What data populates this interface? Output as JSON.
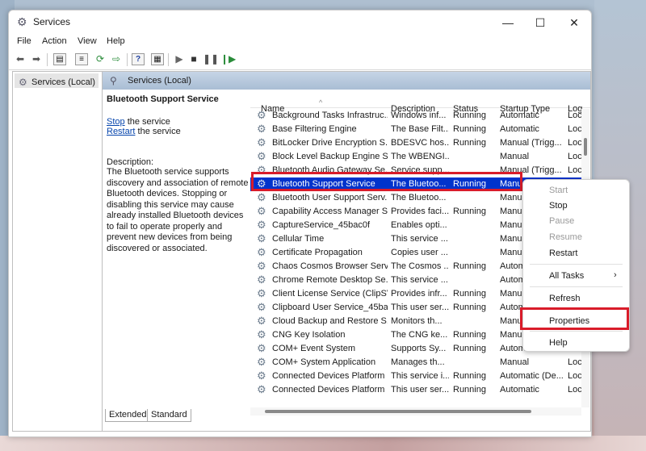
{
  "window": {
    "title": "Services"
  },
  "menu": [
    "File",
    "Action",
    "View",
    "Help"
  ],
  "tree": {
    "label": "Services (Local)"
  },
  "pane_header": "Services (Local)",
  "details": {
    "service_name": "Bluetooth Support Service",
    "stop_link": "Stop",
    "stop_suffix": " the service",
    "restart_link": "Restart",
    "restart_suffix": " the service",
    "description_label": "Description:",
    "description": "The Bluetooth service supports discovery and association of remote Bluetooth devices.  Stopping or disabling this service may cause already installed Bluetooth devices to fail to operate properly and prevent new devices from being discovered or associated."
  },
  "columns": [
    "Name",
    "Description",
    "Status",
    "Startup Type",
    "Log"
  ],
  "rows": [
    {
      "name": "Background Tasks Infrastruc...",
      "desc": "Windows inf...",
      "status": "Running",
      "startup": "Automatic",
      "log": "Loc"
    },
    {
      "name": "Base Filtering Engine",
      "desc": "The Base Filt...",
      "status": "Running",
      "startup": "Automatic",
      "log": "Loc"
    },
    {
      "name": "BitLocker Drive Encryption S...",
      "desc": "BDESVC hos...",
      "status": "Running",
      "startup": "Manual (Trigg...",
      "log": "Loc"
    },
    {
      "name": "Block Level Backup Engine S...",
      "desc": "The WBENGI...",
      "status": "",
      "startup": "Manual",
      "log": "Loc"
    },
    {
      "name": "Bluetooth Audio Gateway Se...",
      "desc": "Service supp...",
      "status": "",
      "startup": "Manual (Trigg...",
      "log": "Loc"
    },
    {
      "name": "Bluetooth Support Service",
      "desc": "The Bluetoo...",
      "status": "Running",
      "startup": "Manu",
      "log": ""
    },
    {
      "name": "Bluetooth User Support Serv...",
      "desc": "The Bluetoo...",
      "status": "",
      "startup": "Manu",
      "log": ""
    },
    {
      "name": "Capability Access Manager S...",
      "desc": "Provides faci...",
      "status": "Running",
      "startup": "Manu",
      "log": ""
    },
    {
      "name": "CaptureService_45bac0f",
      "desc": "Enables opti...",
      "status": "",
      "startup": "Manu",
      "log": ""
    },
    {
      "name": "Cellular Time",
      "desc": "This service ...",
      "status": "",
      "startup": "Manu",
      "log": ""
    },
    {
      "name": "Certificate Propagation",
      "desc": "Copies user ...",
      "status": "",
      "startup": "Manu",
      "log": ""
    },
    {
      "name": "Chaos Cosmos Browser Servi...",
      "desc": "The Cosmos ...",
      "status": "Running",
      "startup": "Autom",
      "log": ""
    },
    {
      "name": "Chrome Remote Desktop Se...",
      "desc": "This service ...",
      "status": "",
      "startup": "Autom",
      "log": ""
    },
    {
      "name": "Client License Service (ClipSV...",
      "desc": "Provides infr...",
      "status": "Running",
      "startup": "Manu",
      "log": ""
    },
    {
      "name": "Clipboard User Service_45ba...",
      "desc": "This user ser...",
      "status": "Running",
      "startup": "Autom",
      "log": ""
    },
    {
      "name": "Cloud Backup and Restore S...",
      "desc": "Monitors th...",
      "status": "",
      "startup": "Manu",
      "log": ""
    },
    {
      "name": "CNG Key Isolation",
      "desc": "The CNG ke...",
      "status": "Running",
      "startup": "Manu",
      "log": ""
    },
    {
      "name": "COM+ Event System",
      "desc": "Supports Sy...",
      "status": "Running",
      "startup": "Autom",
      "log": ""
    },
    {
      "name": "COM+ System Application",
      "desc": "Manages th...",
      "status": "",
      "startup": "Manual",
      "log": "Loc"
    },
    {
      "name": "Connected Devices Platform ...",
      "desc": "This service i...",
      "status": "Running",
      "startup": "Automatic (De...",
      "log": "Loc"
    },
    {
      "name": "Connected Devices Platform ...",
      "desc": "This user ser...",
      "status": "Running",
      "startup": "Automatic",
      "log": "Loc"
    }
  ],
  "tabs": [
    "Extended",
    "Standard"
  ],
  "context_menu": {
    "start": "Start",
    "stop": "Stop",
    "pause": "Pause",
    "resume": "Resume",
    "restart": "Restart",
    "all_tasks": "All Tasks",
    "all_tasks_arrow": "›",
    "refresh": "Refresh",
    "properties": "Properties",
    "help": "Help"
  },
  "colors": {
    "highlight": "#d91c2a",
    "selection": "#0033cc",
    "header": "#a9bdd4"
  }
}
